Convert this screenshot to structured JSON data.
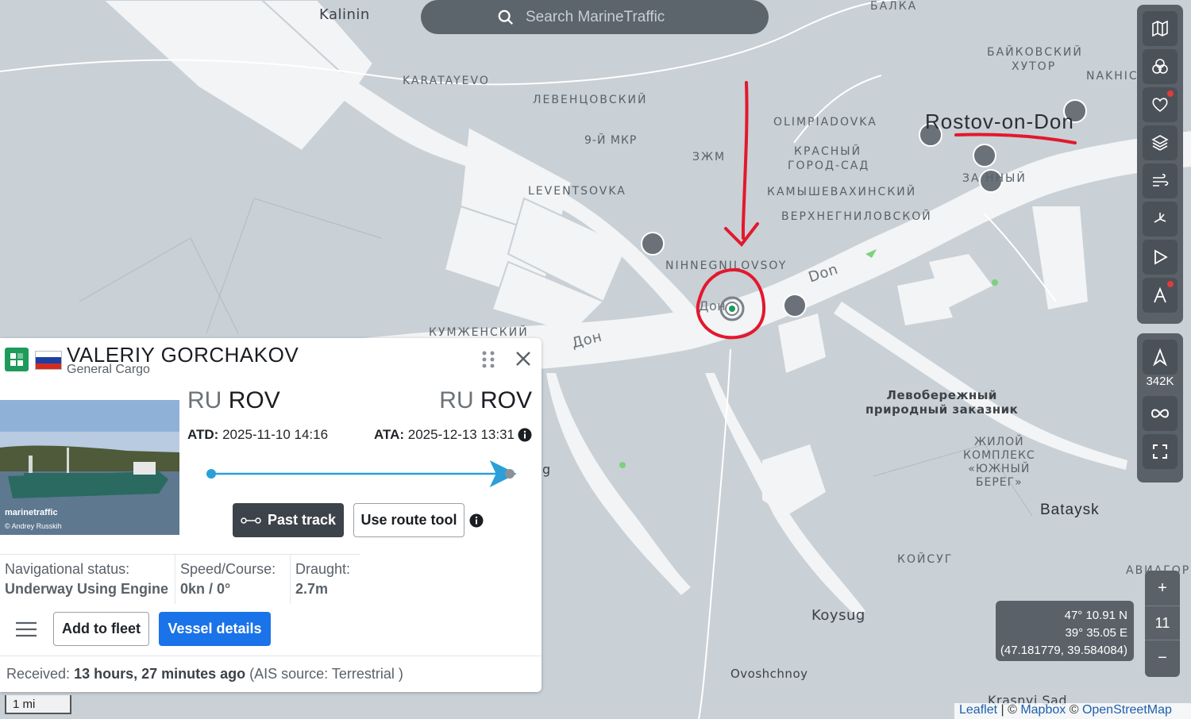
{
  "search": {
    "placeholder": "Search MarineTraffic"
  },
  "map_labels": {
    "kalinin": "Kalinin",
    "balka": "БАЛКА",
    "baikovsky": "БАЙКОВСКИЙ",
    "khutor": "ХУТОР",
    "nakhic": "NAKHIC",
    "karatayevo": "KARATAYEVO",
    "levencovsky": "ЛЕВЕНЦОВСКИЙ",
    "olimpiadovka": "OLIMPIADOVKA",
    "rostov": "Rostov-on-Don",
    "mkr9": "9-Й МКР",
    "zzhm": "ЗЖМ",
    "krasny": "КРАСНЫЙ",
    "gorod_sad": "ГОРОД-САД",
    "zarechny": "ЗА   ННЫЙ",
    "leventsovka": "LEVENTSOVKA",
    "kamyshevakhinsky": "КАМЫШЕВАХИНСКИЙ",
    "verkhnegnilovskoy": "ВЕРХНЕГНИЛОВСКОЙ",
    "nizhnegnilovsoy": "NIHNEGNILOVSOY",
    "don_en": "Don",
    "don_ru_small": "Дон",
    "don_ru": "Дон",
    "kumzhensky": "КУМЖЕНСКИЙ",
    "levoberezhny_1": "Левобережный",
    "levoberezhny_2": "природный заказник",
    "zhiloy_1": "ЖИЛОЙ",
    "zhiloy_2": "КОМПЛЕКС",
    "zhiloy_3": "«ЮЖНЫЙ",
    "zhiloy_4": "БЕРЕГ»",
    "bataysk": "Bataysk",
    "koysug_ru": "КОЙСУГ",
    "avia": "АВИАГОР",
    "koysug": "Koysug",
    "ovoshchnoy": "Ovoshchnoy",
    "krasny_sad": "Krasnyi Sad",
    "g": "g"
  },
  "toolbar": {
    "icons": [
      "map-icon",
      "filters-icon",
      "heart-icon",
      "layers-icon",
      "wind-icon",
      "density-icon",
      "play-icon",
      "measure-icon"
    ],
    "vessel_count": "342K"
  },
  "coords": {
    "lat": "47° 10.91 N",
    "lon": "39° 35.05 E",
    "decimal": "(47.181779, 39.584084)"
  },
  "zoom": {
    "plus": "+",
    "level": "11",
    "minus": "−"
  },
  "attribution": {
    "leaflet": "Leaflet",
    "sep1": " | © ",
    "mapbox": "Mapbox",
    "sep2": " © ",
    "osm": "OpenStreetMap"
  },
  "scale": {
    "label": "1 mi"
  },
  "vessel": {
    "name": "VALERIY GORCHAKOV",
    "type": "General Cargo",
    "flag_colors": [
      "#ffffff",
      "#1c3fa6",
      "#d52b1e"
    ],
    "from_country": "RU",
    "from_port": "ROV",
    "to_country": "RU",
    "to_port": "ROV",
    "atd_label": "ATD:",
    "atd_value": "2025-11-10 14:16",
    "ata_label": "ATA:",
    "ata_value": "2025-12-13 13:31",
    "progress": 0.97,
    "photo_brand": "marinetraffic",
    "photo_credit": "© Andrey Russkih",
    "past_track": "Past track",
    "route_tool": "Use route tool",
    "nav_status_label": "Navigational status:",
    "nav_status_value": "Underway Using Engine",
    "speed_label": "Speed/Course:",
    "speed_value": "0kn / 0°",
    "draught_label": "Draught:",
    "draught_value": "2.7m",
    "add_fleet": "Add to fleet",
    "details": "Vessel details",
    "received_label": "Received:",
    "received_value": "13 hours, 27 minutes ago",
    "received_source": "(AIS source: Terrestrial )"
  },
  "colors": {
    "accent": "#1a73e8",
    "annotation": "#e3182d",
    "route": "#2a9fd8",
    "vessel_green": "#1e9a5b"
  }
}
